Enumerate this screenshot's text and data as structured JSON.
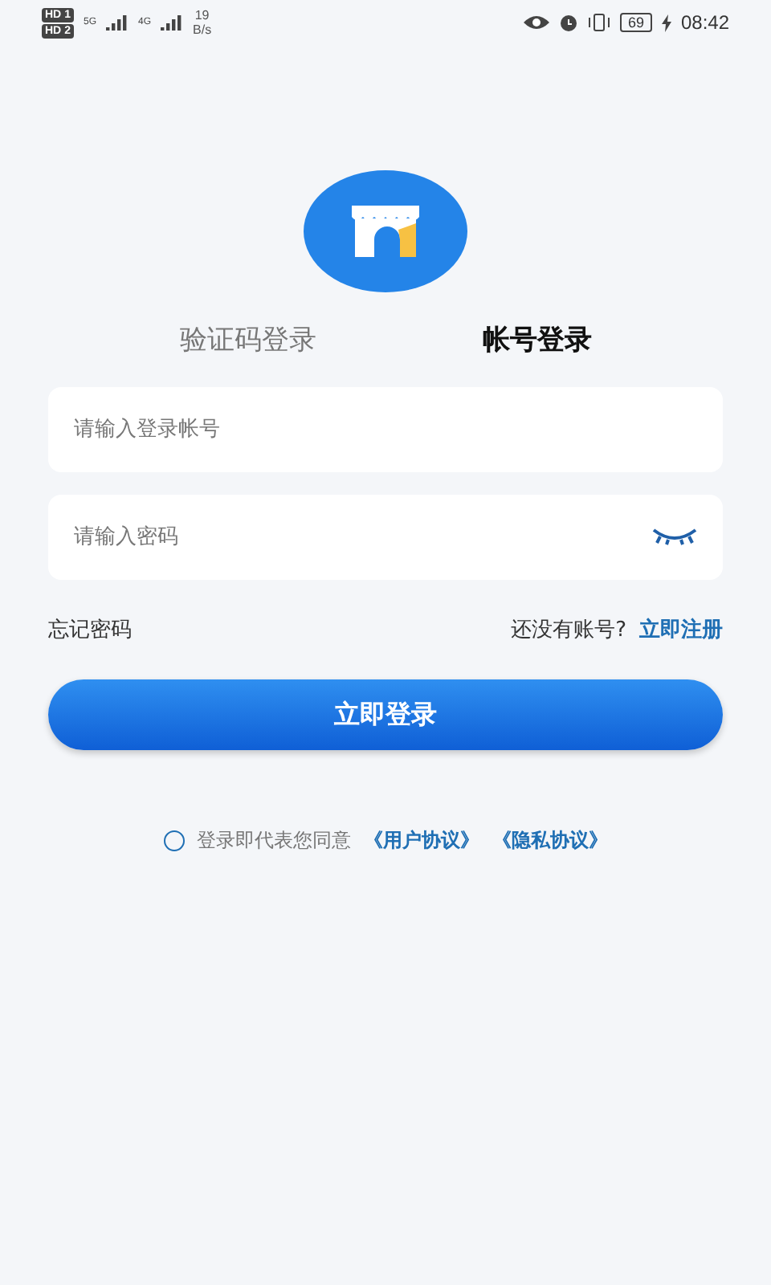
{
  "status_bar": {
    "sims": [
      {
        "badge": "HD",
        "slot": "1",
        "network": "5G"
      },
      {
        "badge": "HD",
        "slot": "2",
        "network": "4G"
      }
    ],
    "speed_value": "19",
    "speed_unit": "B/s",
    "battery": "69",
    "time": "08:42"
  },
  "tabs": [
    {
      "label": "验证码登录",
      "selected": false
    },
    {
      "label": "帐号登录",
      "selected": true
    }
  ],
  "account_field": {
    "placeholder": "请输入登录帐号"
  },
  "password_field": {
    "placeholder": "请输入密码"
  },
  "forgot_link": "忘记密码",
  "no_account": "还没有账号?",
  "register_link": "立即注册",
  "login_button": "立即登录",
  "agreement": {
    "checked": false,
    "text": "登录即代表您同意",
    "links": [
      "《用户协议》",
      "《隐私协议》"
    ]
  }
}
